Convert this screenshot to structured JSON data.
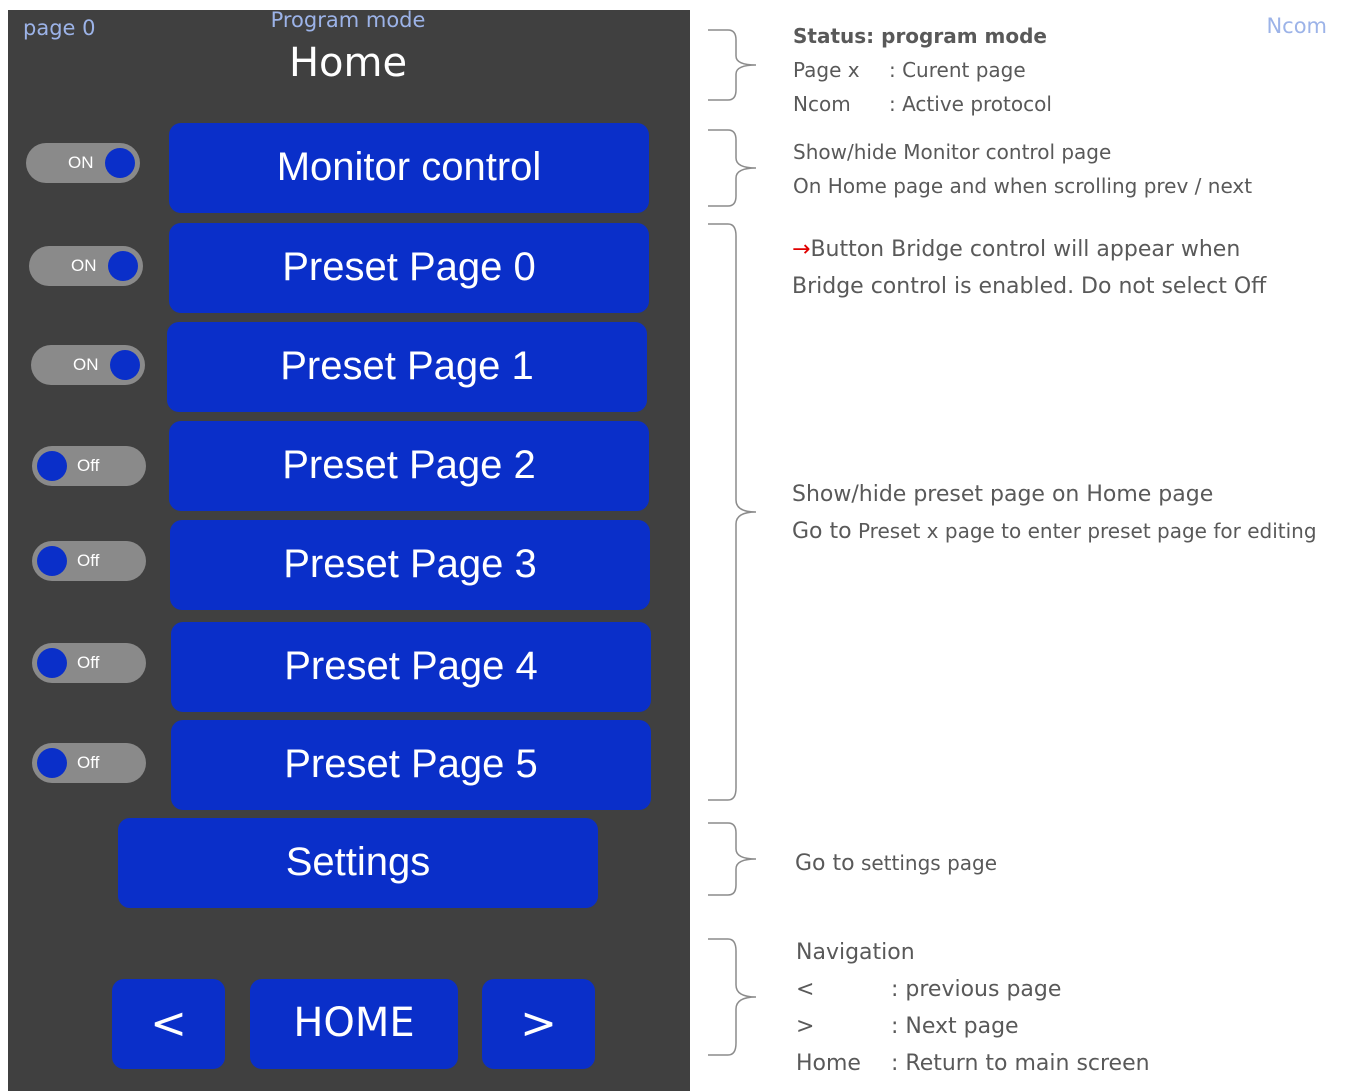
{
  "header": {
    "page_label": "page 0",
    "mode_label": "Program mode",
    "protocol_label": "Ncom",
    "title": "Home"
  },
  "menu": [
    {
      "label": "Monitor control",
      "toggle": "ON"
    },
    {
      "label": "Preset Page 0",
      "toggle": "ON"
    },
    {
      "label": "Preset Page 1",
      "toggle": "ON"
    },
    {
      "label": "Preset Page 2",
      "toggle": "Off"
    },
    {
      "label": "Preset Page 3",
      "toggle": "Off"
    },
    {
      "label": "Preset Page 4",
      "toggle": "Off"
    },
    {
      "label": "Preset Page 5",
      "toggle": "Off"
    }
  ],
  "settings_label": "Settings",
  "nav": {
    "prev": "<",
    "home": "HOME",
    "next": ">"
  },
  "notes": {
    "status": {
      "title": "Status: program mode",
      "page_key": "Page x",
      "page_val": ": Curent page",
      "proto_key": "Ncom",
      "proto_val": ": Active protocol"
    },
    "monitor": {
      "line1": "Show/hide Monitor control page",
      "line2": "On Home page and when scrolling prev / next"
    },
    "bridge": {
      "arrow": "→",
      "line1": "Button Bridge control will appear when",
      "line2": "Bridge control is enabled. Do not select Off"
    },
    "preset": {
      "line1": "Show/hide preset page on Home page",
      "line2a": "Go to",
      "line2b": "Preset x page to enter preset page for editing"
    },
    "settings": {
      "a": "Go to",
      "b": "settings page"
    },
    "navigation": {
      "title": "Navigation",
      "prev_key": "<",
      "prev_val": ": previous page",
      "next_key": ">",
      "next_val": ": Next page",
      "home_key": "Home",
      "home_val": ": Return to main screen"
    }
  },
  "colors": {
    "panel": "#404040",
    "button": "#0a2fc9",
    "toggle_track": "#8a8a8a",
    "note_text": "#595959",
    "arrow": "#e00000"
  }
}
